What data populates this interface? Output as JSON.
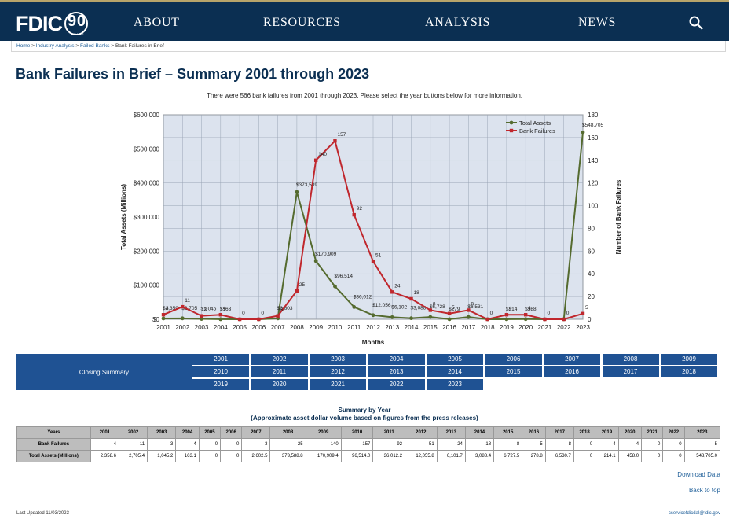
{
  "header": {
    "logo_text": "FDIC",
    "logo_badge": "90",
    "logo_sub": "YEARS",
    "nav": [
      "ABOUT",
      "RESOURCES",
      "ANALYSIS",
      "NEWS"
    ]
  },
  "breadcrumb": {
    "home": "Home",
    "sep": " > ",
    "industry": "Industry Analysis",
    "failed": "Failed Banks",
    "current": "Bank Failures in Brief"
  },
  "page_title": "Bank Failures in Brief – Summary 2001 through 2023",
  "intro": "There were 566 bank failures from 2001 through 2023. Please select the year buttons below for more information.",
  "chart_data": {
    "type": "line",
    "x": [
      "2001",
      "2002",
      "2003",
      "2004",
      "2005",
      "2006",
      "2007",
      "2008",
      "2009",
      "2010",
      "2011",
      "2012",
      "2013",
      "2014",
      "2015",
      "2016",
      "2017",
      "2018",
      "2019",
      "2020",
      "2021",
      "2022",
      "2023"
    ],
    "xlabel": "Months",
    "ylabel_left": "Total Assets (Millions)",
    "ylabel_right": "Number of Bank Failures",
    "ylim_left": [
      0,
      600000
    ],
    "ylim_right": [
      0,
      180
    ],
    "left_ticks": [
      "$0",
      "$100,000",
      "$200,000",
      "$300,000",
      "$400,000",
      "$500,000",
      "$600,000"
    ],
    "right_ticks": [
      "0",
      "20",
      "40",
      "60",
      "80",
      "100",
      "120",
      "140",
      "160",
      "180"
    ],
    "legend_position": "top-right",
    "series": [
      {
        "name": "Total Assets",
        "color": "#556b2f",
        "axis": "left",
        "values": [
          2358.6,
          2705.4,
          1045.2,
          163.1,
          0,
          0,
          2602.5,
          373588.8,
          170909.4,
          96514.0,
          36012.2,
          12055.8,
          6101.7,
          3088.4,
          6727.5,
          278.8,
          6530.7,
          0,
          214.1,
          458.0,
          0,
          0,
          548705.0
        ],
        "labels": [
          "$2,359",
          "$2,705",
          "$1,045",
          "$163",
          "",
          "",
          "$2,603",
          "$373,589",
          "$170,909",
          "$96,514",
          "$36,012",
          "$12,056",
          "$6,102",
          "$3,088",
          "$6,728",
          "$279",
          "$6,531",
          "",
          "$214",
          "$388",
          "",
          "",
          "$548,705"
        ]
      },
      {
        "name": "Bank Failures",
        "color": "#c0272d",
        "axis": "right",
        "values": [
          4,
          11,
          3,
          4,
          0,
          0,
          3,
          25,
          140,
          157,
          92,
          51,
          24,
          18,
          8,
          5,
          8,
          0,
          4,
          4,
          0,
          0,
          5
        ],
        "labels": [
          "4",
          "11",
          "3",
          "4",
          "0",
          "0",
          "3",
          "25",
          "140",
          "157",
          "92",
          "51",
          "24",
          "18",
          "8",
          "5",
          "8",
          "0",
          "4",
          "4",
          "0",
          "0",
          "5"
        ]
      }
    ]
  },
  "closing_summary": "Closing Summary",
  "year_buttons": [
    "2001",
    "2002",
    "2003",
    "2004",
    "2005",
    "2006",
    "2007",
    "2008",
    "2009",
    "2010",
    "2011",
    "2012",
    "2013",
    "2014",
    "2015",
    "2016",
    "2017",
    "2018",
    "2019",
    "2020",
    "2021",
    "2022",
    "2023"
  ],
  "summary": {
    "title": "Summary by Year",
    "subtitle": "(Approximate asset dollar volume based on figures from the press releases)",
    "years_header": "Years",
    "years": [
      "2001",
      "2002",
      "2003",
      "2004",
      "2005",
      "2006",
      "2007",
      "2008",
      "2009",
      "2010",
      "2011",
      "2012",
      "2013",
      "2014",
      "2015",
      "2016",
      "2017",
      "2018",
      "2019",
      "2020",
      "2021",
      "2022",
      "2023"
    ],
    "rows": [
      {
        "label": "Bank Failures",
        "values": [
          "4",
          "11",
          "3",
          "4",
          "0",
          "0",
          "3",
          "25",
          "140",
          "157",
          "92",
          "51",
          "24",
          "18",
          "8",
          "5",
          "8",
          "0",
          "4",
          "4",
          "0",
          "0",
          "5"
        ]
      },
      {
        "label": "Total Assets (Millions)",
        "values": [
          "2,358.6",
          "2,705.4",
          "1,045.2",
          "163.1",
          "0",
          "0",
          "2,602.5",
          "373,588.8",
          "170,909.4",
          "96,514.0",
          "36,012.2",
          "12,055.8",
          "6,101.7",
          "3,088.4",
          "6,727.5",
          "278.8",
          "6,530.7",
          "0",
          "214.1",
          "458.0",
          "0",
          "0",
          "548,705.0"
        ]
      }
    ]
  },
  "links": {
    "download": "Download Data",
    "top": "Back to top"
  },
  "footer": {
    "updated": "Last Updated 11/03/2023",
    "email": "cservicefdicdal@fdic.gov"
  }
}
